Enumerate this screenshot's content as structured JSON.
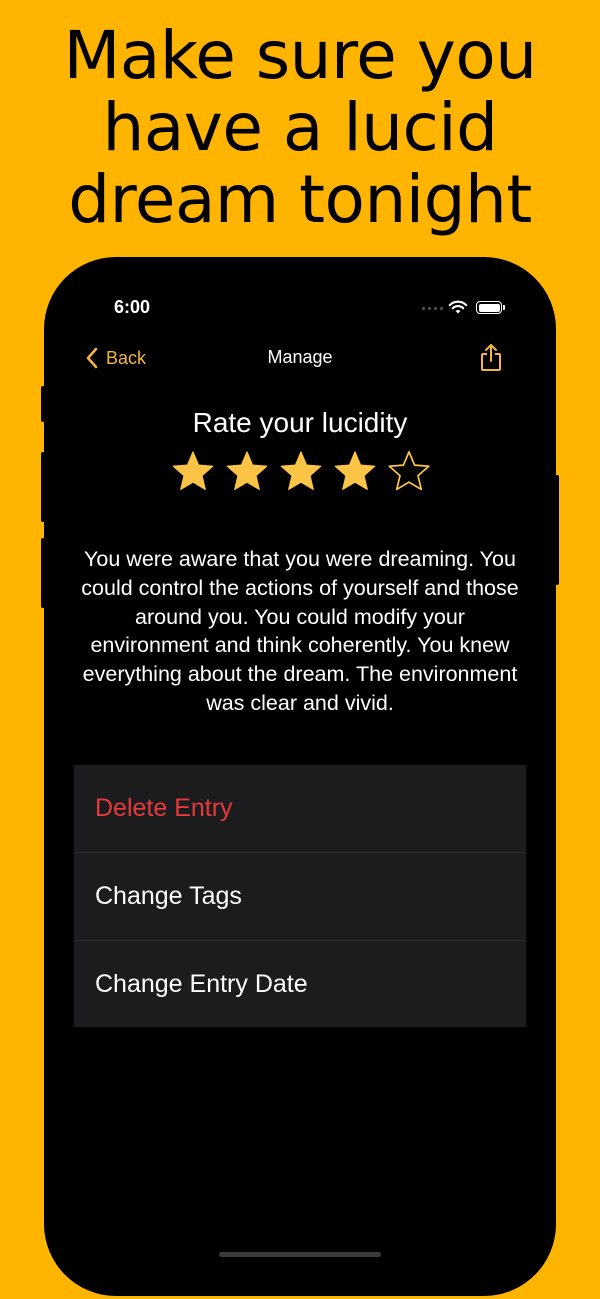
{
  "headline": {
    "lines": [
      "Make sure you",
      "have a lucid",
      "dream tonight"
    ]
  },
  "status_bar": {
    "time": "6:00"
  },
  "navbar": {
    "back_label": "Back",
    "title": "Manage"
  },
  "rating": {
    "title": "Rate your lucidity",
    "value": 4,
    "max": 5,
    "star_color": "#FCC447"
  },
  "description": "You were aware that you were dreaming. You could control the actions of yourself and those around you. You could modify your environment and think coherently. You knew everything about the dream. The environment was clear and vivid.",
  "menu": {
    "items": [
      {
        "label": "Delete Entry",
        "style": "destructive"
      },
      {
        "label": "Change Tags",
        "style": "default"
      },
      {
        "label": "Change Entry Date",
        "style": "default"
      }
    ]
  },
  "colors": {
    "background": "#FFB400",
    "accent": "#F5B53F",
    "destructive": "#E5393B",
    "list_background": "#1C1C1E"
  },
  "icons": {
    "back": "chevron-left-icon",
    "share": "share-icon",
    "wifi": "wifi-icon",
    "battery": "battery-icon"
  }
}
